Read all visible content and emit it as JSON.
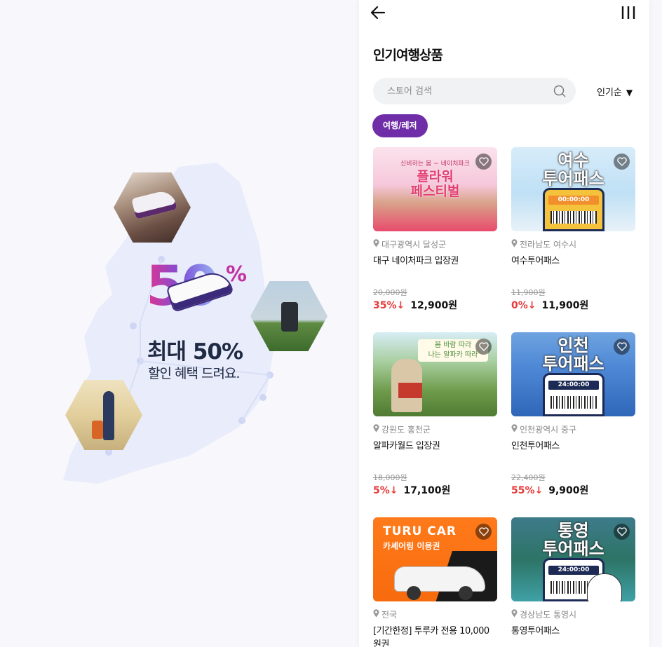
{
  "promo": {
    "big_number": "50",
    "percent_sign": "%",
    "headline": "최대 50%",
    "subline": "할인 혜택 드려요."
  },
  "header": {
    "back_icon": "arrow-left-icon",
    "menu_icon": "menu-icon"
  },
  "page_title": "인기여행상품",
  "search": {
    "placeholder": "스토어 검색",
    "value": ""
  },
  "sort": {
    "label": "인기순",
    "caret": "▼"
  },
  "category_chip": "여행/레저",
  "colors": {
    "accent": "#6f2da8",
    "discount": "#e83a3a"
  },
  "products": [
    {
      "image_text_1": "신비하는 봄 ~",
      "image_text_2": "네이처파크",
      "image_text_3": "플라워",
      "image_text_4": "페스티벌",
      "location": "대구광역시 달성군",
      "name": "대구 네이처파크 입장권",
      "original_price": "20,000원",
      "discount": "35%↓",
      "price": "12,900원"
    },
    {
      "image_text_1": "여수",
      "image_text_2": "투어패스",
      "image_text_3": "00:00:00",
      "location": "전라남도 여수시",
      "name": "여수투어패스",
      "original_price": "11,900원",
      "discount": "0%↓",
      "price": "11,900원"
    },
    {
      "image_text_1": "봄 바람 따라",
      "image_text_2": "나는 알파카 따라",
      "location": "강원도 홍천군",
      "name": "알파카월드 입장권",
      "original_price": "18,000원",
      "discount": "5%↓",
      "price": "17,100원"
    },
    {
      "image_text_1": "인천",
      "image_text_2": "투어패스",
      "image_text_3": "24:00:00",
      "location": "인천광역시 중구",
      "name": "인천투어패스",
      "original_price": "22,400원",
      "discount": "55%↓",
      "price": "9,900원"
    },
    {
      "image_text_1": "TURU CAR",
      "image_text_2": "카셰어링 이용권",
      "location": "전국",
      "name": "[기간한정] 투루카 전용 10,000원권",
      "original_price": "",
      "discount": "",
      "price": ""
    },
    {
      "image_text_1": "통영",
      "image_text_2": "투어패스",
      "image_text_3": "24:00:00",
      "location": "경상남도 통영시",
      "name": "통영투어패스",
      "original_price": "",
      "discount": "",
      "price": ""
    }
  ]
}
